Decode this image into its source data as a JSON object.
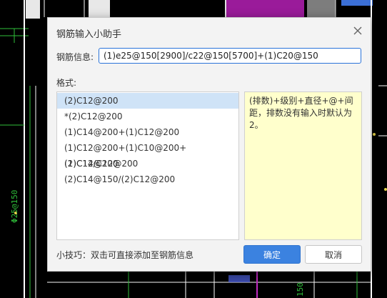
{
  "dialog": {
    "title": "钢筋输入小助手",
    "field_label": "钢筋信息:",
    "field_value": "(1)e25@150[2900]/c22@150[5700]+(1)C20@150",
    "format_label": "格式:",
    "formats": [
      "(2)C12@200",
      "*(2)C12@200",
      "(1)C14@200+(1)C12@200",
      "(1)C12@200+(1)C10@200+(1)C12@200",
      "(2)C14/C12@200",
      "(2)C14@150/(2)C12@200"
    ],
    "selected_index": 0,
    "description": "(排数)+级别+直径+@+间距，排数没有输入时默认为2。",
    "tip": "小技巧：双击可直接添加至钢筋信息",
    "ok_label": "确定",
    "cancel_label": "取消"
  },
  "cad": {
    "left_label": "Φ25@150",
    "bottom_label": "150"
  },
  "colors": {
    "accent": "#3b82e0",
    "selection": "#cfe3f7",
    "desc_bg": "#ffffcc",
    "cad_green": "#2fbf3a",
    "cad_magenta": "#c22cc2"
  },
  "icons": {
    "close": "close-icon"
  }
}
